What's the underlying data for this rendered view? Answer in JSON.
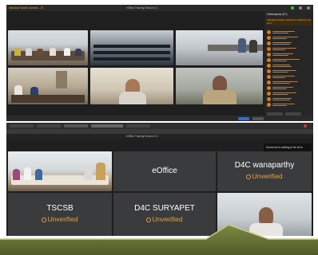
{
  "top_window": {
    "title_left": "Indhukuri Sarath Chandra - 19",
    "title_center": "eOffice Training Session V.1",
    "panel_title": "Participants (57)",
    "panel_banner": "Indhukuri Sarath Chandra is waiting to be let in"
  },
  "bottom_window": {
    "title_center": "eOffice Training Session V.1",
    "notification": "Someone is waiting to be let in",
    "tiles": [
      {
        "name": "eOffice",
        "status": ""
      },
      {
        "name": "D4C wanaparthy",
        "status": "Unverified"
      },
      {
        "name": "TSCSB",
        "status": "Unverified"
      },
      {
        "name": "D4C SURYAPET",
        "status": "Unverified"
      }
    ]
  },
  "colors": {
    "accent_orange": "#e07b1f",
    "unverified": "#e6a23c",
    "tile_gray": "#3a3b3d",
    "ribbon": "#6c7a3c"
  }
}
